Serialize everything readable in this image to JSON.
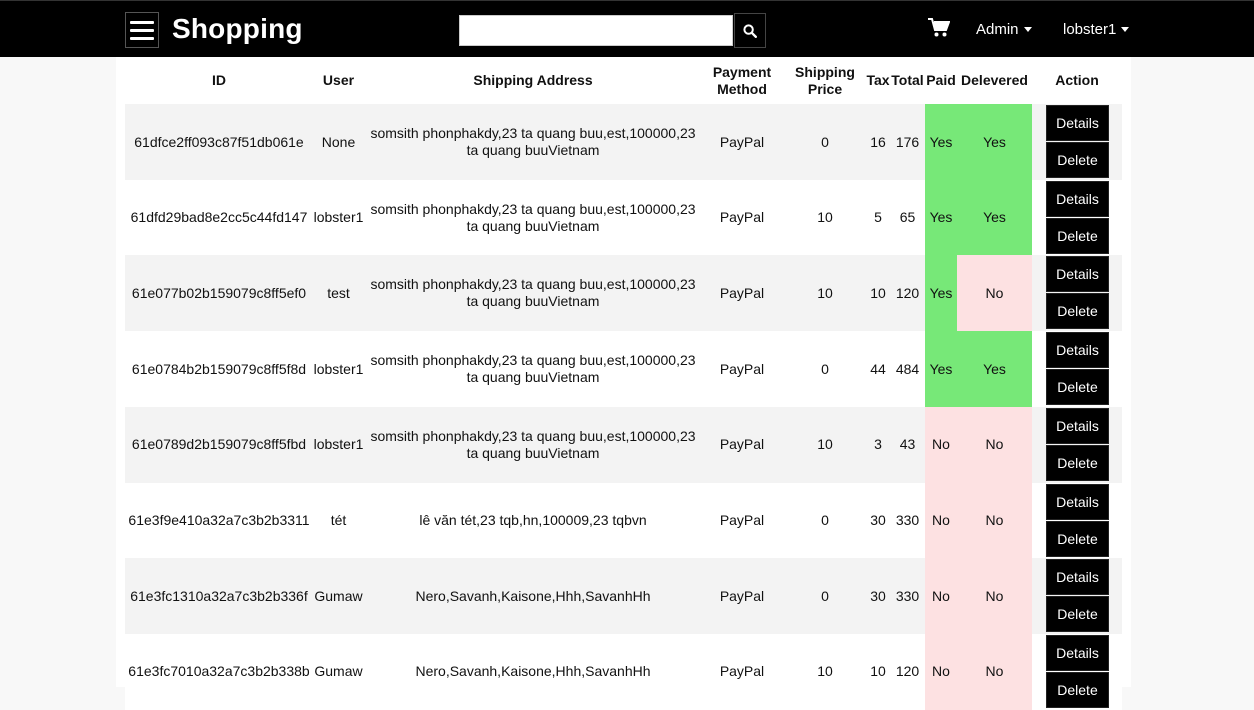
{
  "navbar": {
    "brand": "Shopping",
    "search_value": "",
    "admin_label": "Admin",
    "user_label": "lobster1"
  },
  "table": {
    "headers": {
      "id": "ID",
      "user": "User",
      "address": "Shipping Address",
      "payment": "Payment Method",
      "shipping": "Shipping Price",
      "tax": "Tax",
      "total": "Total",
      "paid": "Paid",
      "delivered": "Delevered",
      "action": "Action"
    },
    "details_label": "Details",
    "delete_label": "Delete",
    "rows": [
      {
        "id": "61dfce2ff093c87f51db061e",
        "user": "None",
        "address": "somsith phonphakdy,23 ta quang buu,est,100000,23 ta quang buuVietnam",
        "payment": "PayPal",
        "shipping": "0",
        "tax": "16",
        "total": "176",
        "paid": "Yes",
        "delivered": "Yes"
      },
      {
        "id": "61dfd29bad8e2cc5c44fd147",
        "user": "lobster1",
        "address": "somsith phonphakdy,23 ta quang buu,est,100000,23 ta quang buuVietnam",
        "payment": "PayPal",
        "shipping": "10",
        "tax": "5",
        "total": "65",
        "paid": "Yes",
        "delivered": "Yes"
      },
      {
        "id": "61e077b02b159079c8ff5ef0",
        "user": "test",
        "address": "somsith phonphakdy,23 ta quang buu,est,100000,23 ta quang buuVietnam",
        "payment": "PayPal",
        "shipping": "10",
        "tax": "10",
        "total": "120",
        "paid": "Yes",
        "delivered": "No"
      },
      {
        "id": "61e0784b2b159079c8ff5f8d",
        "user": "lobster1",
        "address": "somsith phonphakdy,23 ta quang buu,est,100000,23 ta quang buuVietnam",
        "payment": "PayPal",
        "shipping": "0",
        "tax": "44",
        "total": "484",
        "paid": "Yes",
        "delivered": "Yes"
      },
      {
        "id": "61e0789d2b159079c8ff5fbd",
        "user": "lobster1",
        "address": "somsith phonphakdy,23 ta quang buu,est,100000,23 ta quang buuVietnam",
        "payment": "PayPal",
        "shipping": "10",
        "tax": "3",
        "total": "43",
        "paid": "No",
        "delivered": "No"
      },
      {
        "id": "61e3f9e410a32a7c3b2b3311",
        "user": "tét",
        "address": "lê văn tét,23 tqb,hn,100009,23 tqbvn",
        "payment": "PayPal",
        "shipping": "0",
        "tax": "30",
        "total": "330",
        "paid": "No",
        "delivered": "No"
      },
      {
        "id": "61e3fc1310a32a7c3b2b336f",
        "user": "Gumaw",
        "address": "Nero,Savanh,Kaisone,Hhh,SavanhHh",
        "payment": "PayPal",
        "shipping": "0",
        "tax": "30",
        "total": "330",
        "paid": "No",
        "delivered": "No"
      },
      {
        "id": "61e3fc7010a32a7c3b2b338b",
        "user": "Gumaw",
        "address": "Nero,Savanh,Kaisone,Hhh,SavanhHh",
        "payment": "PayPal",
        "shipping": "10",
        "tax": "10",
        "total": "120",
        "paid": "No",
        "delivered": "No"
      }
    ]
  },
  "colors": {
    "navbar": "#000000",
    "yes_bg": "#77e878",
    "no_bg": "#fde1e2",
    "button": "#000000"
  },
  "icons": {
    "menu": "hamburger-icon",
    "search": "search-icon",
    "cart": "cart-icon"
  }
}
